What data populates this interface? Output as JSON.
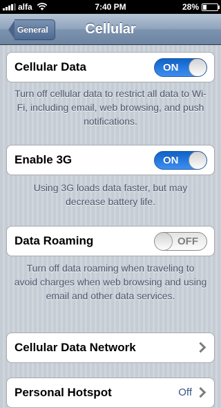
{
  "status": {
    "carrier": "alfa",
    "time": "7:40 PM",
    "battery_text": "28%",
    "battery_level": 0.28
  },
  "nav": {
    "back_label": "General",
    "title": "Cellular"
  },
  "settings": {
    "cellular_data": {
      "label": "Cellular Data",
      "switch_text": "ON",
      "state": "on"
    },
    "cellular_data_footer": "Turn off cellular data to restrict all data to Wi-Fi, including email, web browsing, and push notifications.",
    "enable_3g": {
      "label": "Enable 3G",
      "switch_text": "ON",
      "state": "on"
    },
    "enable_3g_footer": "Using 3G loads data faster, but may decrease battery life.",
    "data_roaming": {
      "label": "Data Roaming",
      "switch_text": "OFF",
      "state": "off"
    },
    "data_roaming_footer": "Turn off data roaming when traveling to avoid charges when web browsing and using email and other data services.",
    "cellular_network": {
      "label": "Cellular Data Network"
    },
    "personal_hotspot": {
      "label": "Personal Hotspot",
      "value": "Off"
    }
  },
  "colors": {
    "switch_on": "#1a6fd9",
    "nav_bar": "#8ea3bc",
    "background": "#cbd2d8"
  }
}
